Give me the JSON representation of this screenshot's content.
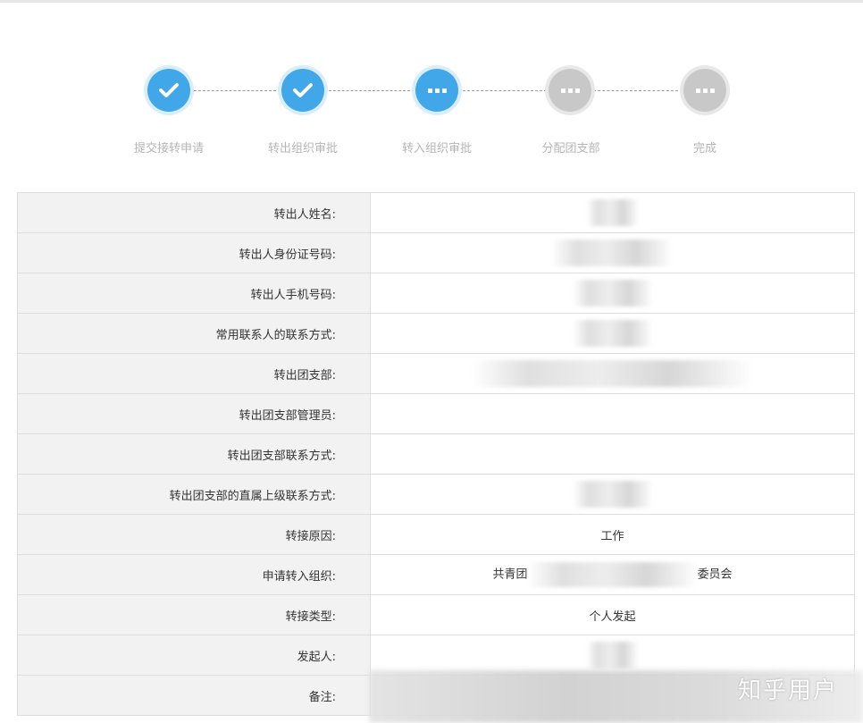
{
  "steps": [
    {
      "label": "提交接转申请",
      "status": "done"
    },
    {
      "label": "转出组织审批",
      "status": "done"
    },
    {
      "label": "转入组织审批",
      "status": "active"
    },
    {
      "label": "分配团支部",
      "status": "todo"
    },
    {
      "label": "完成",
      "status": "todo"
    }
  ],
  "colors": {
    "accent": "#41a7e8",
    "pending": "#c8c8c8"
  },
  "rows": [
    {
      "label": "转出人姓名:",
      "value": ""
    },
    {
      "label": "转出人身份证号码:",
      "value": ""
    },
    {
      "label": "转出人手机号码:",
      "value": ""
    },
    {
      "label": "常用联系人的联系方式:",
      "value": ""
    },
    {
      "label": "转出团支部:",
      "value": ""
    },
    {
      "label": "转出团支部管理员:",
      "value": ""
    },
    {
      "label": "转出团支部联系方式:",
      "value": ""
    },
    {
      "label": "转出团支部的直属上级联系方式:",
      "value": ""
    },
    {
      "label": "转接原因:",
      "value": "工作"
    },
    {
      "label": "申请转入组织:",
      "value_prefix": "共青团",
      "value_suffix": "委员会"
    },
    {
      "label": "转接类型:",
      "value": "个人发起"
    },
    {
      "label": "发起人:",
      "value": ""
    },
    {
      "label": "备注:",
      "value": ""
    }
  ],
  "watermark": "知乎用户"
}
